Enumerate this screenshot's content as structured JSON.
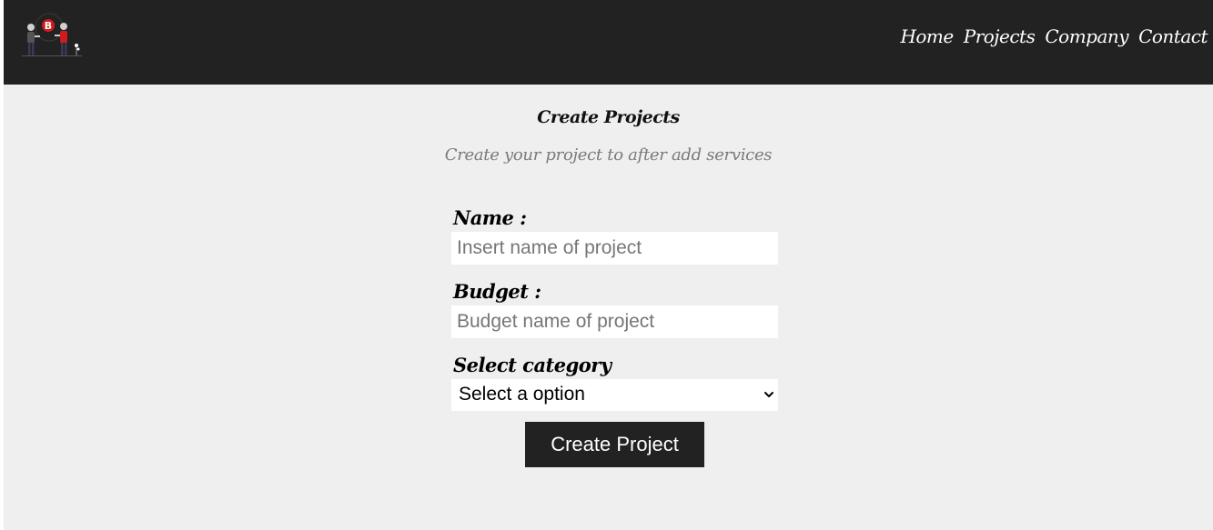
{
  "navbar": {
    "links": [
      "Home",
      "Projects",
      "Company",
      "Contact"
    ],
    "background": "#222222",
    "logo_icon": "people-bitcoin-illustration-icon"
  },
  "header": {
    "title": "Create Projects",
    "subtitle": "Create your project to after add services"
  },
  "form": {
    "name": {
      "label": "Name :",
      "placeholder": "Insert name of project",
      "value": ""
    },
    "budget": {
      "label": "Budget :",
      "placeholder": "Budget name of project",
      "value": ""
    },
    "category": {
      "label": "Select category",
      "selected": "Select a option"
    },
    "submit_label": "Create Project"
  },
  "colors": {
    "page_background": "#efefef",
    "accent_red": "#d11a1a",
    "button_background": "#222222"
  }
}
